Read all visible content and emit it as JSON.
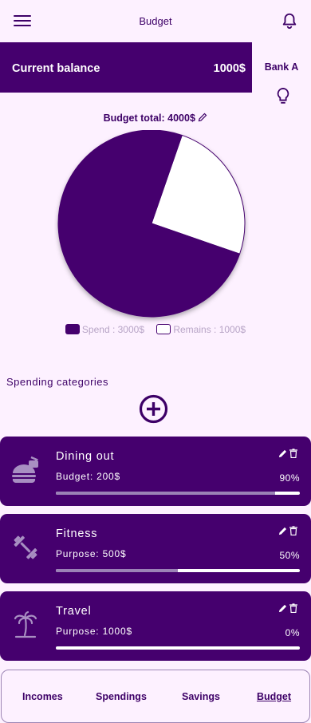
{
  "header": {
    "title": "Budget",
    "menu_icon": "hamburger-menu-icon",
    "notification_icon": "bell-icon"
  },
  "balance": {
    "label": "Current balance",
    "value": "1000$",
    "bank": "Bank A",
    "tip_icon": "lightbulb-icon"
  },
  "budget": {
    "total_label": "Budget total: 4000$",
    "edit_icon": "pencil-icon"
  },
  "chart_data": {
    "type": "pie",
    "slices": [
      {
        "label": "Spend : 3000$",
        "value": 3000,
        "color": "#45006e"
      },
      {
        "label": "Remains : 1000$",
        "value": 1000,
        "color": "#ffffff"
      }
    ],
    "legend_position": "bottom"
  },
  "categories": {
    "title": "Spending categories",
    "add_icon": "plus-circle-icon",
    "items": [
      {
        "name": "Dining out",
        "amount": "Budget: 200$",
        "percent": "90%",
        "progress": 0.9,
        "icon": "food-icon"
      },
      {
        "name": "Fitness",
        "amount": "Purpose: 500$",
        "percent": "50%",
        "progress": 0.5,
        "icon": "dumbbell-icon"
      },
      {
        "name": "Travel",
        "amount": "Purpose: 1000$",
        "percent": "0%",
        "progress": 0.0,
        "icon": "palm-tree-icon"
      }
    ]
  },
  "nav": {
    "items": [
      "Incomes",
      "Spendings",
      "Savings",
      "Budget"
    ],
    "active": "Budget"
  },
  "colors": {
    "primary": "#45006e",
    "background": "#fdf1ff",
    "progress_fill": "#9b82b6"
  }
}
